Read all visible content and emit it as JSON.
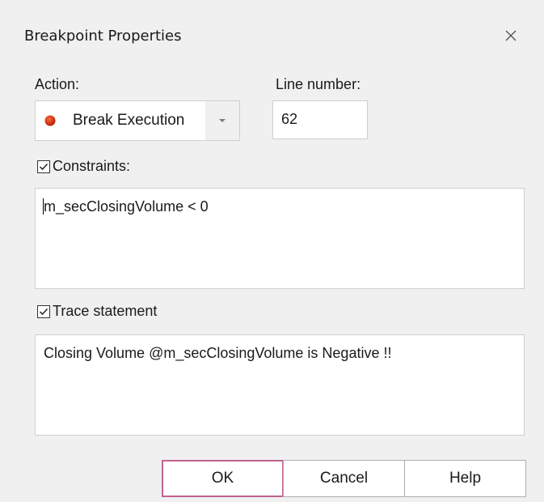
{
  "dialog": {
    "title": "Breakpoint Properties",
    "close_icon": "close-icon"
  },
  "action": {
    "label": "Action:",
    "selected": "Break Execution",
    "icon": "red-circle-icon",
    "icon_color": "#cc2200"
  },
  "line_number": {
    "label": "Line number:",
    "value": "62"
  },
  "constraints": {
    "checked": true,
    "label": "Constraints:",
    "value": "m_secClosingVolume < 0"
  },
  "trace": {
    "checked": true,
    "label": "Trace statement",
    "value": "Closing Volume @m_secClosingVolume is Negative !!"
  },
  "buttons": {
    "ok": "OK",
    "cancel": "Cancel",
    "help": "Help"
  },
  "colors": {
    "default_button_border": "#c2638f"
  }
}
